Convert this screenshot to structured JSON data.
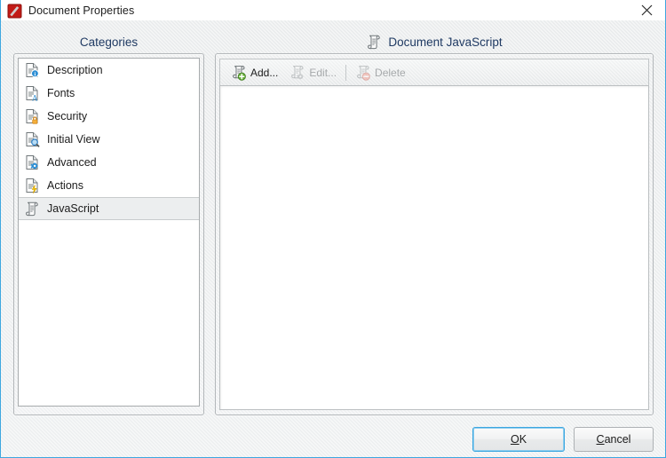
{
  "window": {
    "title": "Document Properties",
    "icon": "pdf-application-icon",
    "close_label": "Close"
  },
  "categories_panel": {
    "header": "Categories",
    "items": [
      {
        "label": "Description",
        "icon": "document-info-icon",
        "selected": false
      },
      {
        "label": "Fonts",
        "icon": "document-font-icon",
        "selected": false
      },
      {
        "label": "Security",
        "icon": "document-lock-icon",
        "selected": false
      },
      {
        "label": "Initial View",
        "icon": "document-search-icon",
        "selected": false
      },
      {
        "label": "Advanced",
        "icon": "document-gear-icon",
        "selected": false
      },
      {
        "label": "Actions",
        "icon": "document-lightning-icon",
        "selected": false
      },
      {
        "label": "JavaScript",
        "icon": "script-scroll-icon",
        "selected": true
      }
    ]
  },
  "document_panel": {
    "header": "Document JavaScript",
    "header_icon": "script-scroll-icon",
    "toolbar": [
      {
        "label": "Add...",
        "icon": "script-add-icon",
        "enabled": true
      },
      {
        "label": "Edit...",
        "icon": "script-edit-icon",
        "enabled": false
      },
      {
        "label": "Delete",
        "icon": "script-delete-icon",
        "enabled": false
      }
    ],
    "list_items": []
  },
  "footer": {
    "ok": {
      "label": "OK",
      "accelerator": "O",
      "default": true
    },
    "cancel": {
      "label": "Cancel",
      "accelerator": "C",
      "default": false
    }
  },
  "colors": {
    "dialog_border": "#3da7e0",
    "header_text": "#1f3a63",
    "background": "#eef0f1",
    "selection": "#eceeef",
    "disabled_text": "#a6a9ab",
    "accent_green": "#5aa72b",
    "accent_red": "#e8776a",
    "accent_orange": "#f0a32c",
    "accent_blue": "#2f8fd4"
  }
}
